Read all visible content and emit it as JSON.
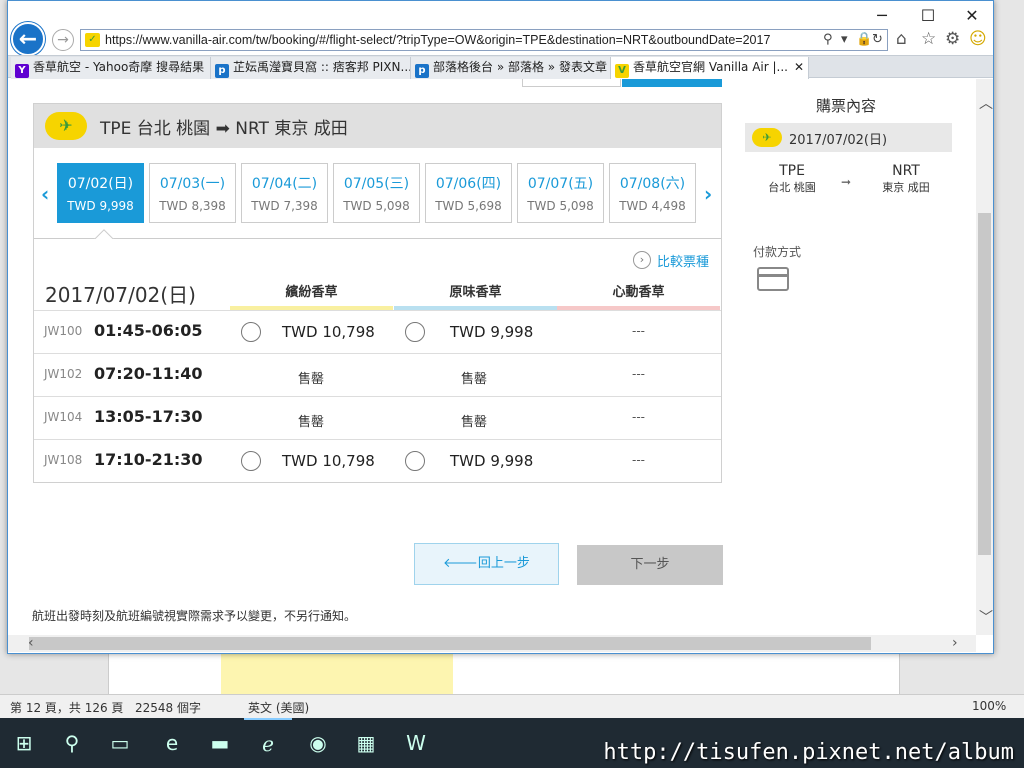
{
  "browser": {
    "url": "https://www.vanilla-air.com/tw/booking/#/flight-select/?tripType=OW&origin=TPE&destination=NRT&outboundDate=2017",
    "tabs": [
      {
        "label": "香草航空 - Yahoo奇摩 搜尋結果",
        "icon": "Y",
        "color": "#5f01d1"
      },
      {
        "label": "芷妘禹瀅寶貝窩 :: 痞客邦 PIXN...",
        "icon": "p",
        "color": "#1a73c8"
      },
      {
        "label": "部落格後台 » 部落格 » 發表文章",
        "icon": "p",
        "color": "#1a73c8"
      },
      {
        "label": "香草航空官網 Vanilla Air |...",
        "icon": "V",
        "color": "#f6d400"
      }
    ],
    "tab_close": "✕"
  },
  "flight": {
    "route": "TPE 台北 桃園 ➡ NRT 東京 成田",
    "dates": [
      {
        "date": "07/02(日)",
        "price": "TWD 9,998",
        "selected": true
      },
      {
        "date": "07/03(一)",
        "price": "TWD 8,398",
        "selected": false
      },
      {
        "date": "07/04(二)",
        "price": "TWD 7,398",
        "selected": false
      },
      {
        "date": "07/05(三)",
        "price": "TWD 5,098",
        "selected": false
      },
      {
        "date": "07/06(四)",
        "price": "TWD 5,698",
        "selected": false
      },
      {
        "date": "07/07(五)",
        "price": "TWD 5,098",
        "selected": false
      },
      {
        "date": "07/08(六)",
        "price": "TWD 4,498",
        "selected": false
      }
    ],
    "compare_label": "比較票種",
    "table_date": "2017/07/02(日)",
    "fare_types": [
      {
        "name": "繽紛香草",
        "color": "#f9f0a0"
      },
      {
        "name": "原味香草",
        "color": "#b9e0f0"
      },
      {
        "name": "心動香草",
        "color": "#f6c8c8"
      }
    ],
    "rows": [
      {
        "no": "JW100",
        "time": "01:45-06:05",
        "fare1": "TWD 10,798",
        "fare2": "TWD 9,998",
        "fare3": "---",
        "available": true
      },
      {
        "no": "JW102",
        "time": "07:20-11:40",
        "fare1": "售罄",
        "fare2": "售罄",
        "fare3": "---",
        "available": false
      },
      {
        "no": "JW104",
        "time": "13:05-17:30",
        "fare1": "售罄",
        "fare2": "售罄",
        "fare3": "---",
        "available": false
      },
      {
        "no": "JW108",
        "time": "17:10-21:30",
        "fare1": "TWD 10,798",
        "fare2": "TWD 9,998",
        "fare3": "---",
        "available": true
      }
    ],
    "prev_button": "回上一步",
    "next_button": "下一步",
    "notice": "航班出發時刻及航班編號視實際需求予以變更，不另行通知。"
  },
  "summary": {
    "title": "購票內容",
    "date": "2017/07/02(日)",
    "origin_code": "TPE",
    "origin_name": "台北 桃園",
    "dest_code": "NRT",
    "dest_name": "東京 成田",
    "payment_label": "付款方式"
  },
  "word_status": {
    "page": "第 12 頁，共 126 頁",
    "words": "22548 個字",
    "lang": "英文 (美國)",
    "zoom": "100%"
  },
  "watermark": "http://tisufen.pixnet.net/album"
}
